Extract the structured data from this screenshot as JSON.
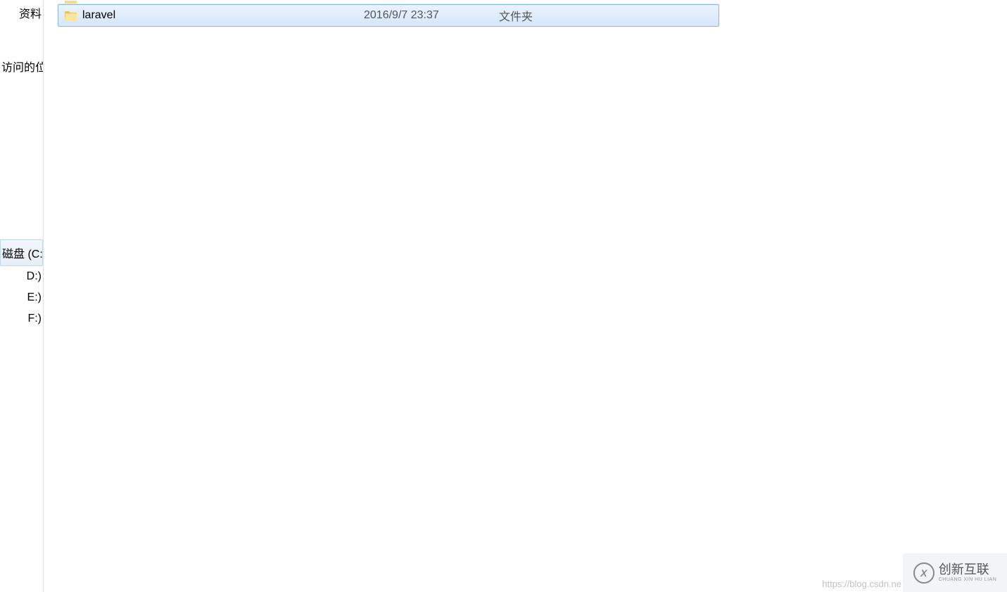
{
  "sidebar": {
    "top_items": [
      {
        "label": "资料"
      },
      {
        "label": "访问的位"
      }
    ],
    "drives": [
      {
        "label": "磁盘 (C:)",
        "selected": true
      },
      {
        "label": "D:)",
        "selected": false
      },
      {
        "label": "E:)",
        "selected": false
      },
      {
        "label": "F:)",
        "selected": false
      }
    ]
  },
  "files": {
    "rows": [
      {
        "name": "laravel",
        "date": "2016/9/7 23:37",
        "type": "文件夹",
        "selected": true
      }
    ]
  },
  "watermark": {
    "logo_mark": "X",
    "logo_main": "创新互联",
    "logo_sub": "CHUANG XIN HU LIAN",
    "url": "https://blog.csdn.ne"
  }
}
